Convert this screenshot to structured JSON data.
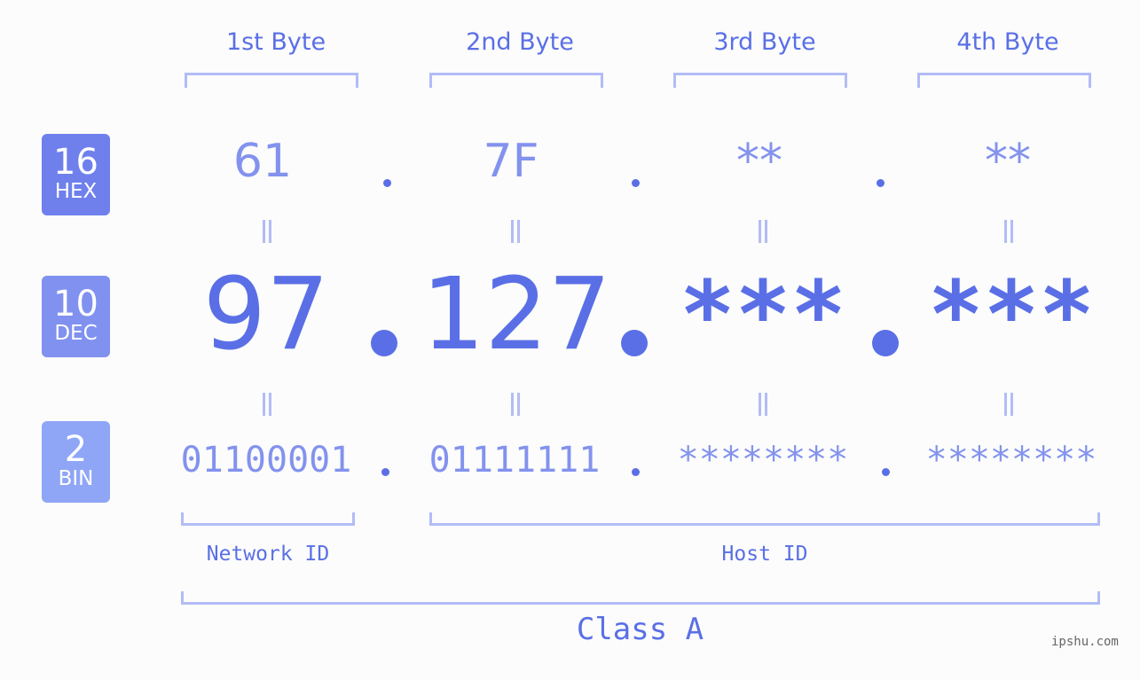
{
  "bytes": [
    {
      "label": "1st Byte",
      "hex": "61",
      "dec": "97",
      "bin": "01100001"
    },
    {
      "label": "2nd Byte",
      "hex": "7F",
      "dec": "127",
      "bin": "01111111"
    },
    {
      "label": "3rd Byte",
      "hex": "**",
      "dec": "***",
      "bin": "********"
    },
    {
      "label": "4th Byte",
      "hex": "**",
      "dec": "***",
      "bin": "********"
    }
  ],
  "badges": {
    "hex": {
      "num": "16",
      "unit": "HEX",
      "color": "#6f80ec"
    },
    "dec": {
      "num": "10",
      "unit": "DEC",
      "color": "#8091f0"
    },
    "bin": {
      "num": "2",
      "unit": "BIN",
      "color": "#8fa6f6"
    }
  },
  "labels": {
    "network_id": "Network ID",
    "host_id": "Host ID",
    "class": "Class A"
  },
  "watermark": "ipshu.com",
  "colors": {
    "accent": "#5a6fe6",
    "light": "#8392ee",
    "bracket": "#b2bcf6"
  }
}
